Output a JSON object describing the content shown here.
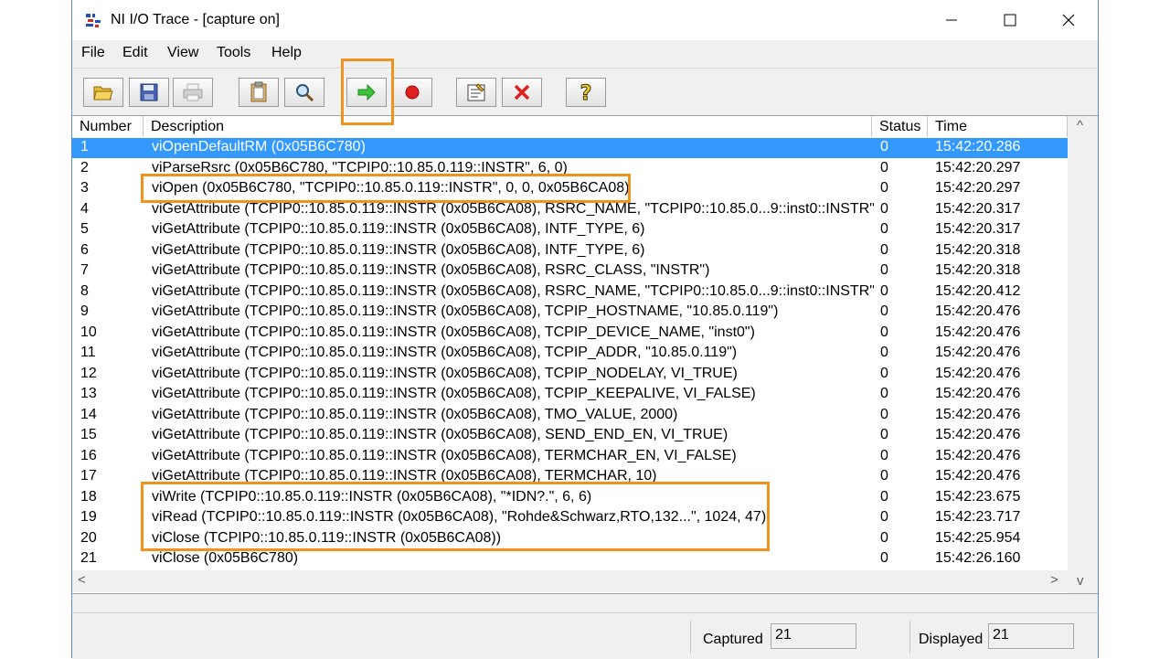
{
  "window": {
    "title": "NI I/O Trace - [capture on]",
    "icons": {
      "minimize": "minimize-icon",
      "maximize": "maximize-icon",
      "close": "close-icon"
    }
  },
  "menu": [
    "File",
    "Edit",
    "View",
    "Tools",
    "Help"
  ],
  "toolbar": [
    {
      "name": "open-button",
      "icon": "folder-open-icon"
    },
    {
      "name": "save-button",
      "icon": "floppy-disk-icon"
    },
    {
      "name": "print-button",
      "icon": "printer-icon"
    },
    {
      "name": "copy-button",
      "icon": "clipboard-icon"
    },
    {
      "name": "find-button",
      "icon": "magnifier-icon"
    },
    {
      "name": "start-capture-button",
      "icon": "green-arrow-icon"
    },
    {
      "name": "stop-capture-button",
      "icon": "red-dot-icon"
    },
    {
      "name": "options-button",
      "icon": "properties-icon"
    },
    {
      "name": "clear-button",
      "icon": "red-x-icon"
    },
    {
      "name": "help-button",
      "icon": "question-mark-icon"
    }
  ],
  "columns": [
    "Number",
    "Description",
    "Status",
    "Time"
  ],
  "rows": [
    {
      "n": "1",
      "desc": "viOpenDefaultRM (0x05B6C780)",
      "status": "0",
      "time": "15:42:20.286"
    },
    {
      "n": "2",
      "desc": "viParseRsrc (0x05B6C780, \"TCPIP0::10.85.0.119::INSTR\", 6, 0)",
      "status": "0",
      "time": "15:42:20.297"
    },
    {
      "n": "3",
      "desc": "viOpen (0x05B6C780, \"TCPIP0::10.85.0.119::INSTR\", 0, 0, 0x05B6CA08)",
      "status": "0",
      "time": "15:42:20.297"
    },
    {
      "n": "4",
      "desc": "viGetAttribute (TCPIP0::10.85.0.119::INSTR (0x05B6CA08), RSRC_NAME, \"TCPIP0::10.85.0...9::inst0::INSTR\")",
      "status": "0",
      "time": "15:42:20.317"
    },
    {
      "n": "5",
      "desc": "viGetAttribute (TCPIP0::10.85.0.119::INSTR (0x05B6CA08), INTF_TYPE, 6)",
      "status": "0",
      "time": "15:42:20.317"
    },
    {
      "n": "6",
      "desc": "viGetAttribute (TCPIP0::10.85.0.119::INSTR (0x05B6CA08), INTF_TYPE, 6)",
      "status": "0",
      "time": "15:42:20.318"
    },
    {
      "n": "7",
      "desc": "viGetAttribute (TCPIP0::10.85.0.119::INSTR (0x05B6CA08), RSRC_CLASS, \"INSTR\")",
      "status": "0",
      "time": "15:42:20.318"
    },
    {
      "n": "8",
      "desc": "viGetAttribute (TCPIP0::10.85.0.119::INSTR (0x05B6CA08), RSRC_NAME, \"TCPIP0::10.85.0...9::inst0::INSTR\")",
      "status": "0",
      "time": "15:42:20.412"
    },
    {
      "n": "9",
      "desc": "viGetAttribute (TCPIP0::10.85.0.119::INSTR (0x05B6CA08), TCPIP_HOSTNAME, \"10.85.0.119\")",
      "status": "0",
      "time": "15:42:20.476"
    },
    {
      "n": "10",
      "desc": "viGetAttribute (TCPIP0::10.85.0.119::INSTR (0x05B6CA08), TCPIP_DEVICE_NAME, \"inst0\")",
      "status": "0",
      "time": "15:42:20.476"
    },
    {
      "n": "11",
      "desc": "viGetAttribute (TCPIP0::10.85.0.119::INSTR (0x05B6CA08), TCPIP_ADDR, \"10.85.0.119\")",
      "status": "0",
      "time": "15:42:20.476"
    },
    {
      "n": "12",
      "desc": "viGetAttribute (TCPIP0::10.85.0.119::INSTR (0x05B6CA08), TCPIP_NODELAY, VI_TRUE)",
      "status": "0",
      "time": "15:42:20.476"
    },
    {
      "n": "13",
      "desc": "viGetAttribute (TCPIP0::10.85.0.119::INSTR (0x05B6CA08), TCPIP_KEEPALIVE, VI_FALSE)",
      "status": "0",
      "time": "15:42:20.476"
    },
    {
      "n": "14",
      "desc": "viGetAttribute (TCPIP0::10.85.0.119::INSTR (0x05B6CA08), TMO_VALUE, 2000)",
      "status": "0",
      "time": "15:42:20.476"
    },
    {
      "n": "15",
      "desc": "viGetAttribute (TCPIP0::10.85.0.119::INSTR (0x05B6CA08), SEND_END_EN, VI_TRUE)",
      "status": "0",
      "time": "15:42:20.476"
    },
    {
      "n": "16",
      "desc": "viGetAttribute (TCPIP0::10.85.0.119::INSTR (0x05B6CA08), TERMCHAR_EN, VI_FALSE)",
      "status": "0",
      "time": "15:42:20.476"
    },
    {
      "n": "17",
      "desc": "viGetAttribute (TCPIP0::10.85.0.119::INSTR (0x05B6CA08), TERMCHAR, 10)",
      "status": "0",
      "time": "15:42:20.476"
    },
    {
      "n": "18",
      "desc": "viWrite (TCPIP0::10.85.0.119::INSTR (0x05B6CA08), \"*IDN?.\", 6, 6)",
      "status": "0",
      "time": "15:42:23.675"
    },
    {
      "n": "19",
      "desc": "viRead (TCPIP0::10.85.0.119::INSTR (0x05B6CA08), \"Rohde&Schwarz,RTO,132...\", 1024, 47)",
      "status": "0",
      "time": "15:42:23.717"
    },
    {
      "n": "20",
      "desc": "viClose (TCPIP0::10.85.0.119::INSTR (0x05B6CA08))",
      "status": "0",
      "time": "15:42:25.954"
    },
    {
      "n": "21",
      "desc": "viClose (0x05B6C780)",
      "status": "0",
      "time": "15:42:26.160"
    }
  ],
  "selected_row": "1",
  "status": {
    "captured_label": "Captured",
    "captured_value": "21",
    "displayed_label": "Displayed",
    "displayed_value": "21"
  },
  "colors": {
    "highlight": "#f0921e",
    "selection": "#3399ff"
  }
}
